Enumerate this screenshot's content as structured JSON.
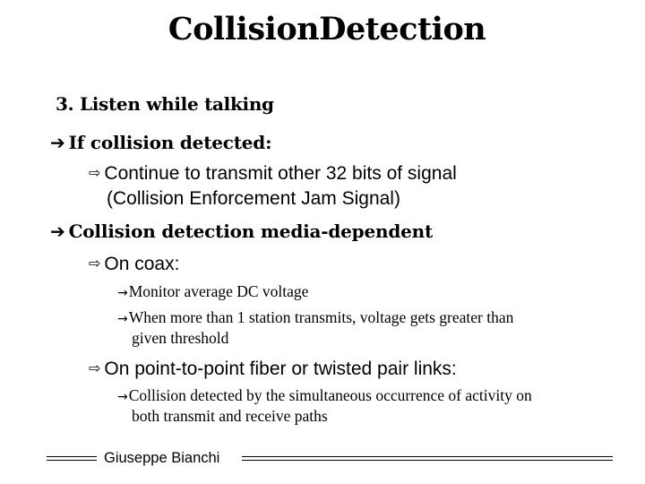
{
  "slide": {
    "title": "CollisionDetection",
    "subtitle": "3. Listen while talking",
    "bullets": [
      {
        "level": 1,
        "icon": "arrow-right-bold-icon",
        "glyph": "➔",
        "text": "If collision detected:"
      },
      {
        "level": 2,
        "icon": "hollow-arrow-right-icon",
        "glyph": "⇨",
        "text": "Continue to transmit other 32 bits of signal",
        "continuation": "(Collision Enforcement Jam Signal)"
      },
      {
        "level": 1,
        "icon": "arrow-right-bold-icon",
        "glyph": "➔",
        "text": "Collision detection media-dependent"
      },
      {
        "level": 2,
        "icon": "hollow-arrow-right-icon",
        "glyph": "⇨",
        "text": "On coax:"
      },
      {
        "level": 3,
        "icon": "arrow-right-icon",
        "glyph": "→",
        "text": "Monitor average DC voltage"
      },
      {
        "level": 3,
        "icon": "arrow-right-icon",
        "glyph": "→",
        "text": "When more than 1 station transmits, voltage gets greater than",
        "continuation": "given threshold"
      },
      {
        "level": 2,
        "icon": "hollow-arrow-right-icon",
        "glyph": "⇨",
        "text": "On point-to-point fiber or twisted pair links:"
      },
      {
        "level": 3,
        "icon": "arrow-right-icon",
        "glyph": "→",
        "text": "Collision detected by the simultaneous occurrence of activity on",
        "continuation": "both transmit and receive paths"
      }
    ]
  },
  "footer": {
    "author": "Giuseppe Bianchi"
  }
}
